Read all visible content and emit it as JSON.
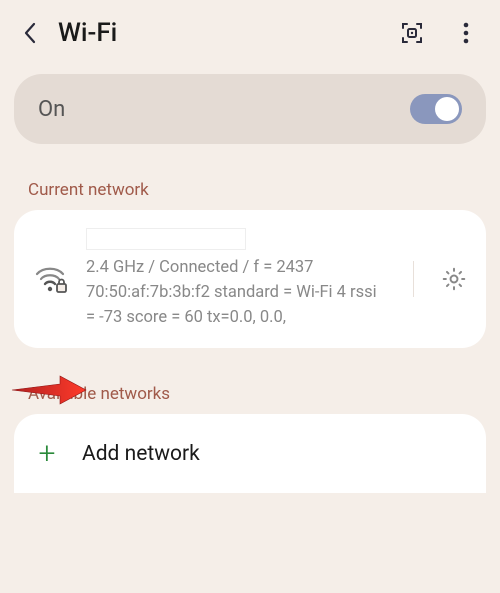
{
  "header": {
    "title": "Wi-Fi"
  },
  "toggle": {
    "label": "On",
    "state": true
  },
  "sections": {
    "current": "Current network",
    "available": "Available networks"
  },
  "current_network": {
    "detail": "2.4 GHz / Connected / f = 2437 70:50:af:7b:3b:f2 standard = Wi-Fi 4 rssi = -73 score = 60  tx=0.0, 0.0,"
  },
  "add_network": {
    "label": "Add network"
  }
}
